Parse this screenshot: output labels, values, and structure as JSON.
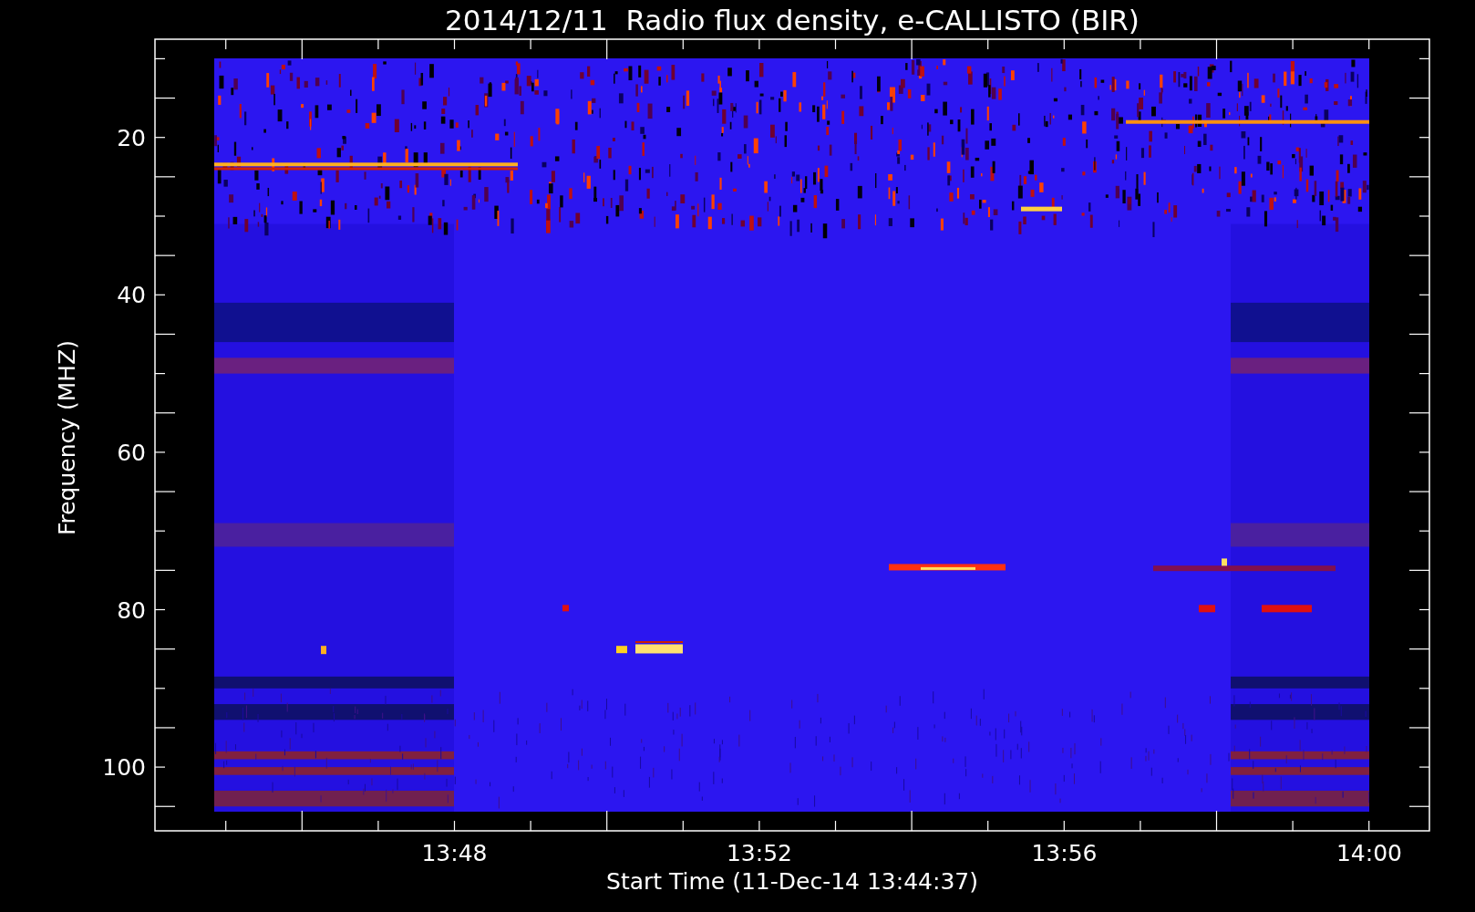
{
  "title": "2014/12/11  Radio flux density, e-CALLISTO (BIR)",
  "y_axis": {
    "label": "Frequency (MHZ)",
    "ticks": [
      "20",
      "40",
      "60",
      "80",
      "100"
    ]
  },
  "x_axis": {
    "label": "Start Time (11-Dec-14 13:44:37)",
    "ticks": [
      "13:48",
      "13:52",
      "13:56",
      "14:00"
    ]
  }
}
